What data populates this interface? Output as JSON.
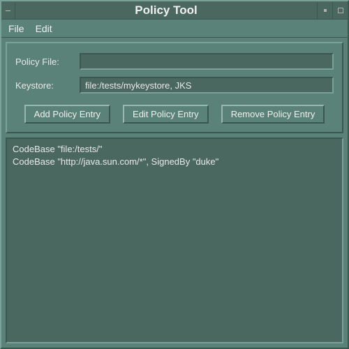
{
  "window": {
    "title": "Policy Tool"
  },
  "menubar": {
    "file": "File",
    "edit": "Edit"
  },
  "fields": {
    "policy_file": {
      "label": "Policy File:",
      "value": ""
    },
    "keystore": {
      "label": "Keystore:",
      "value": "file:/tests/mykeystore, JKS"
    }
  },
  "buttons": {
    "add": "Add Policy Entry",
    "edit": "Edit Policy Entry",
    "remove": "Remove Policy Entry"
  },
  "entries": [
    "CodeBase \"file:/tests/\"",
    "CodeBase \"http://java.sun.com/*\", SignedBy \"duke\""
  ]
}
